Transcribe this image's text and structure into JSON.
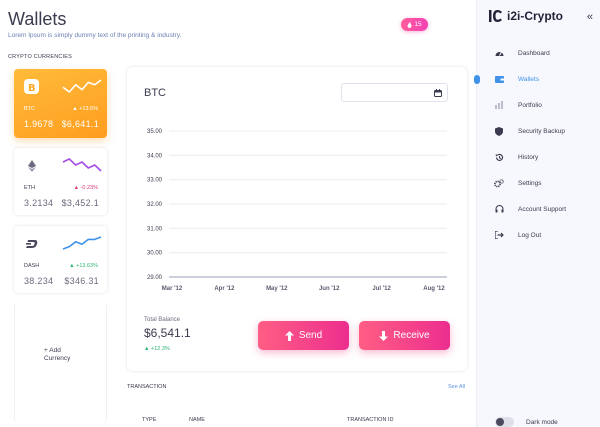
{
  "header": {
    "title": "Wallets",
    "subtitle": "Lorem Ipsum is simply dummy text of the printing & industry.",
    "notification_count": "15"
  },
  "wallets": {
    "section_label": "CRYPTO CURRENCIES",
    "cards": [
      {
        "symbol": "BTC",
        "amount": "1.9678",
        "value": "$6,641.1",
        "change": "+13.6%",
        "icon": "bitcoin-icon",
        "sparkline": [
          5,
          3,
          6,
          4,
          7,
          6,
          8
        ]
      },
      {
        "symbol": "ETH",
        "amount": "3.2134",
        "value": "$3,452.1",
        "change": "-0.23%",
        "icon": "ethereum-icon",
        "sparkline": [
          7,
          8,
          6,
          7,
          5,
          6,
          4
        ]
      },
      {
        "symbol": "DASH",
        "amount": "38.234",
        "value": "$346.31",
        "change": "+13.63%",
        "icon": "dash-icon",
        "sparkline": [
          3,
          4,
          6,
          5,
          7,
          7,
          8
        ]
      }
    ],
    "add_label_line1": "+ Add",
    "add_label_line2": "Currency"
  },
  "chart": {
    "title": "BTC",
    "date_value": "",
    "chart_data": {
      "type": "line",
      "y_ticks": [
        "35.00",
        "34.00",
        "33.00",
        "32.00",
        "31.00",
        "30.00",
        "29.00"
      ],
      "ylim": [
        29,
        35
      ],
      "x_ticks": [
        "Mar '12",
        "Apr '12",
        "May '12",
        "Jun '12",
        "Jul '12",
        "Aug '12"
      ],
      "grid": true,
      "series": []
    },
    "total_label": "Total Balance",
    "total_value": "$6,541.1",
    "total_change": "+12.3%",
    "send_label": "Send",
    "receive_label": "Receive"
  },
  "transactions": {
    "label": "TRANSACTION",
    "see_all": "See All",
    "columns": [
      "TYPE",
      "NAME",
      "TRANSACTION ID"
    ]
  },
  "sidebar": {
    "brand": "i2i-Crypto",
    "collapse_icon": "double-chevron-left-icon",
    "items": [
      {
        "label": "Dashboard",
        "icon": "speedometer-icon",
        "active": false
      },
      {
        "label": "Wallets",
        "icon": "wallet-icon",
        "active": true
      },
      {
        "label": "Portfolio",
        "icon": "bar-chart-icon",
        "active": false
      },
      {
        "label": "Security Backup",
        "icon": "shield-icon",
        "active": false
      },
      {
        "label": "History",
        "icon": "history-icon",
        "active": false
      },
      {
        "label": "Settings",
        "icon": "gears-icon",
        "active": false
      },
      {
        "label": "Account Support",
        "icon": "headset-icon",
        "active": false
      },
      {
        "label": "Log Out",
        "icon": "logout-icon",
        "active": false
      }
    ],
    "dark_mode_label": "Dark mode",
    "dark_mode_on": false
  },
  "colors": {
    "accent": "#3f92e8",
    "btc_gradient_start": "#ffbb3a",
    "btc_gradient_end": "#ff9d1f",
    "button_gradient_start": "#ff5e84",
    "button_gradient_end": "#ec2e8e",
    "positive": "#2bb673",
    "negative": "#e0357a"
  }
}
